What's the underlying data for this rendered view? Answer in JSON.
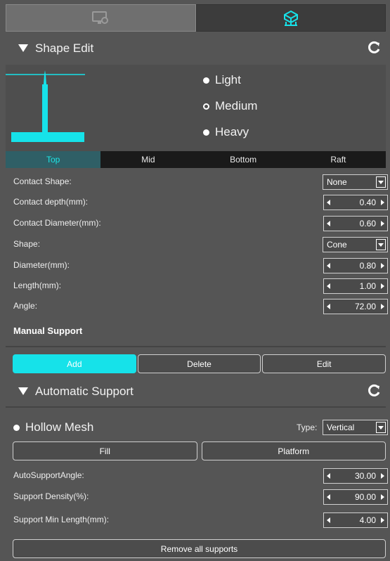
{
  "top_tabs": [
    {
      "icon": "monitor-gear-icon"
    },
    {
      "icon": "support-cube-icon"
    }
  ],
  "shape_edit": {
    "title": "Shape Edit",
    "density_options": [
      {
        "label": "Light",
        "selected": false
      },
      {
        "label": "Medium",
        "selected": true
      },
      {
        "label": "Heavy",
        "selected": false
      }
    ],
    "tabs": [
      "Top",
      "Mid",
      "Bottom",
      "Raft"
    ],
    "active_tab": "Top",
    "properties": {
      "contact_shape": {
        "label": "Contact Shape:",
        "value": "None"
      },
      "contact_depth": {
        "label": "Contact depth(mm):",
        "value": "0.40"
      },
      "contact_diameter": {
        "label": "Contact Diameter(mm):",
        "value": "0.60"
      },
      "shape": {
        "label": "Shape:",
        "value": "Cone"
      },
      "diameter": {
        "label": "Diameter(mm):",
        "value": "0.80"
      },
      "length": {
        "label": "Length(mm):",
        "value": "1.00"
      },
      "angle": {
        "label": "Angle:",
        "value": "72.00"
      }
    }
  },
  "manual_support": {
    "title": "Manual Support",
    "buttons": {
      "add": "Add",
      "delete": "Delete",
      "edit": "Edit"
    }
  },
  "automatic_support": {
    "title": "Automatic Support",
    "hollow_mesh": "Hollow Mesh",
    "type_label": "Type:",
    "type_value": "Vertical",
    "fill": "Fill",
    "platform": "Platform",
    "auto_support_angle": {
      "label": "AutoSupportAngle:",
      "value": "30.00"
    },
    "support_density": {
      "label": "Support Density(%):",
      "value": "90.00"
    },
    "support_min_length": {
      "label": "Support Min Length(mm):",
      "value": "4.00"
    },
    "remove_all": "Remove all supports"
  },
  "colors": {
    "accent": "#16e2e9",
    "panel": "#555555",
    "dark": "#1a1a1a"
  }
}
